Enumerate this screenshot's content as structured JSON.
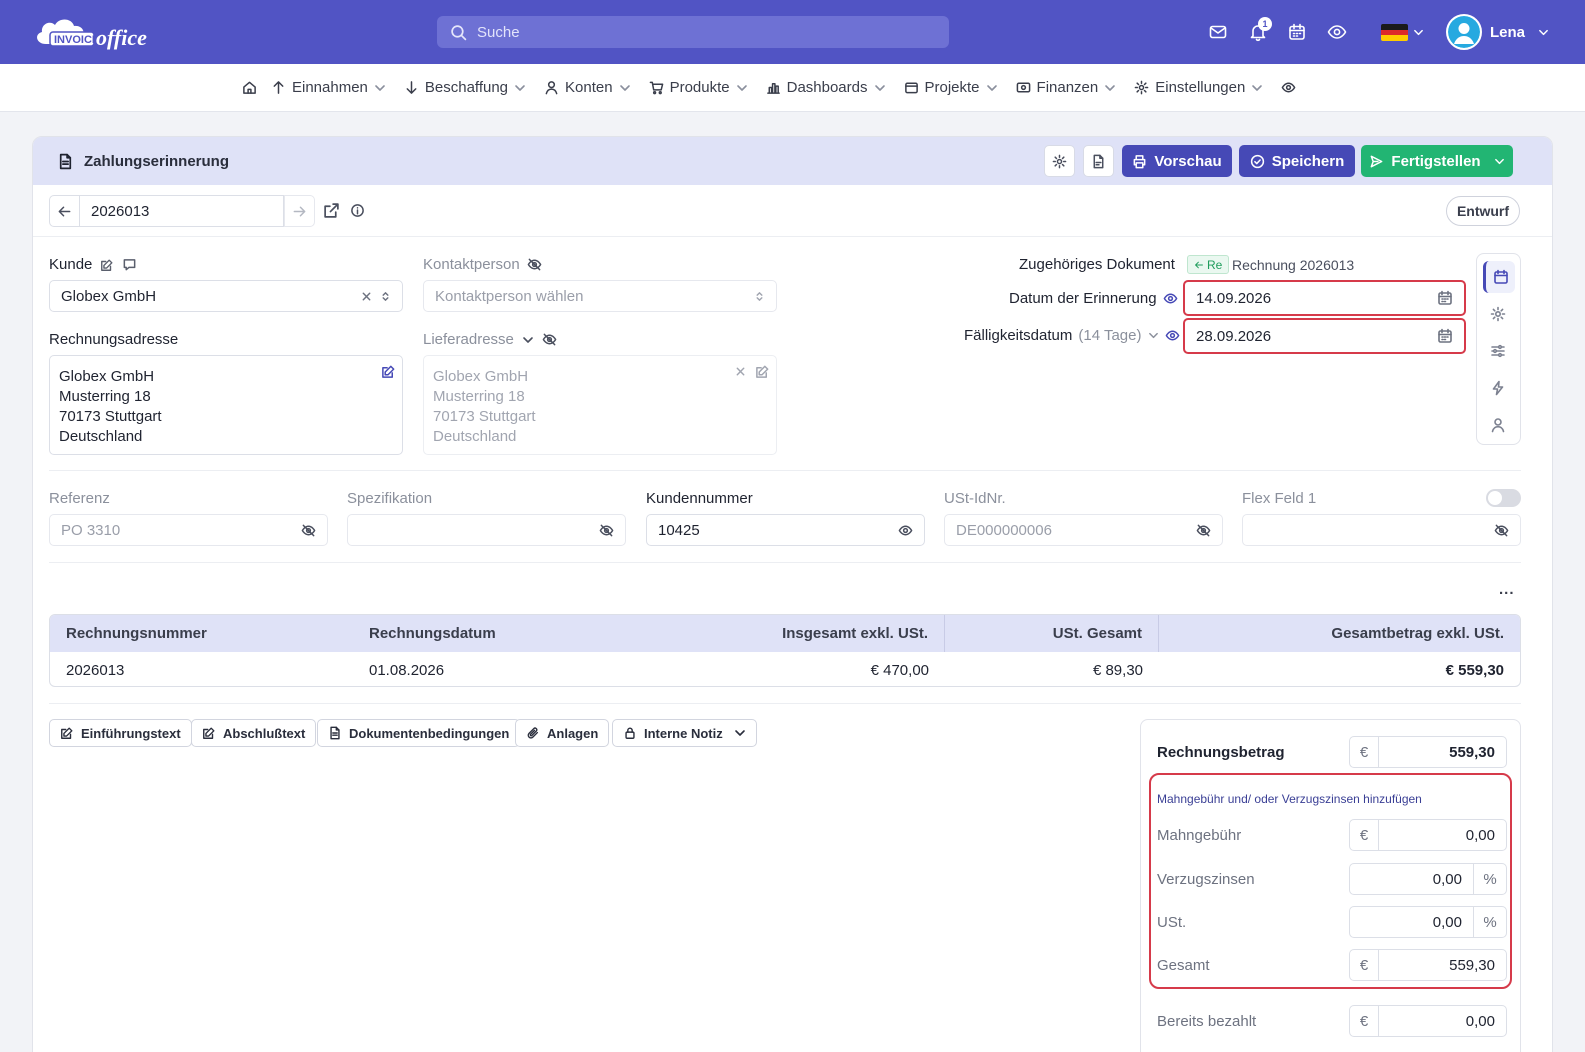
{
  "app": {
    "logo_text": "INVOICE office"
  },
  "search": {
    "placeholder": "Suche"
  },
  "notifications": {
    "count": "1"
  },
  "user": {
    "name": "Lena"
  },
  "colors": {
    "brand": "#5154c4",
    "accent_blue": "#4649b6",
    "accent_green": "#22b573",
    "highlight_red": "#d63a4a"
  },
  "nav": {
    "items": [
      "Einnahmen",
      "Beschaffung",
      "Konten",
      "Produkte",
      "Dashboards",
      "Projekte",
      "Finanzen",
      "Einstellungen"
    ]
  },
  "document": {
    "title": "Zahlungserinnerung",
    "buttons": {
      "preview": "Vorschau",
      "save": "Speichern",
      "finish": "Fertigstellen"
    },
    "number": "2026013",
    "status": "Entwurf"
  },
  "customer": {
    "label": "Kunde",
    "value": "Globex GmbH",
    "contact_label": "Kontaktperson",
    "contact_placeholder": "Kontaktperson wählen",
    "billing_label": "Rechnungsadresse",
    "billing_address": [
      "Globex GmbH",
      "Musterring 18",
      "70173 Stuttgart",
      "Deutschland"
    ],
    "delivery_label": "Lieferadresse",
    "delivery_address": [
      "Globex GmbH",
      "Musterring 18",
      "70173 Stuttgart",
      "Deutschland"
    ]
  },
  "related": {
    "label": "Zugehöriges Dokument",
    "tag": "Re",
    "doc": "Rechnung 2026013",
    "reminder_date_label": "Datum der Erinnerung",
    "reminder_date": "14.09.2026",
    "due_label": "Fälligkeitsdatum",
    "due_days": "(14 Tage)",
    "due_date": "28.09.2026"
  },
  "fields": {
    "reference": {
      "label": "Referenz",
      "value": "PO 3310"
    },
    "specification": {
      "label": "Spezifikation",
      "value": ""
    },
    "customer_number": {
      "label": "Kundennummer",
      "value": "10425"
    },
    "vat_id": {
      "label": "USt-IdNr.",
      "value": "DE000000006"
    },
    "flex": {
      "label": "Flex Feld 1",
      "value": ""
    }
  },
  "table": {
    "headers": [
      "Rechnungsnummer",
      "Rechnungsdatum",
      "Insgesamt exkl. USt.",
      "USt. Gesamt",
      "Gesamtbetrag exkl. USt."
    ],
    "rows": [
      [
        "2026013",
        "01.08.2026",
        "€ 470,00",
        "€ 89,30",
        "€ 559,30"
      ]
    ],
    "more": "..."
  },
  "text_buttons": [
    "Einführungstext",
    "Abschlußtext",
    "Dokumentenbedingungen",
    "Anlagen",
    "Interne Notiz"
  ],
  "summary": {
    "invoice_amount_label": "Rechnungsbetrag",
    "invoice_amount": "559,30",
    "currency": "€",
    "add_fees_label": "Mahngebühr und/ oder Verzugszinsen hinzufügen",
    "fee_label": "Mahngebühr",
    "fee": "0,00",
    "interest_label": "Verzugszinsen",
    "interest": "0,00",
    "vat_label": "USt.",
    "vat": "0,00",
    "percent": "%",
    "total_label": "Gesamt",
    "total": "559,30",
    "paid_label": "Bereits bezahlt",
    "paid": "0,00"
  }
}
